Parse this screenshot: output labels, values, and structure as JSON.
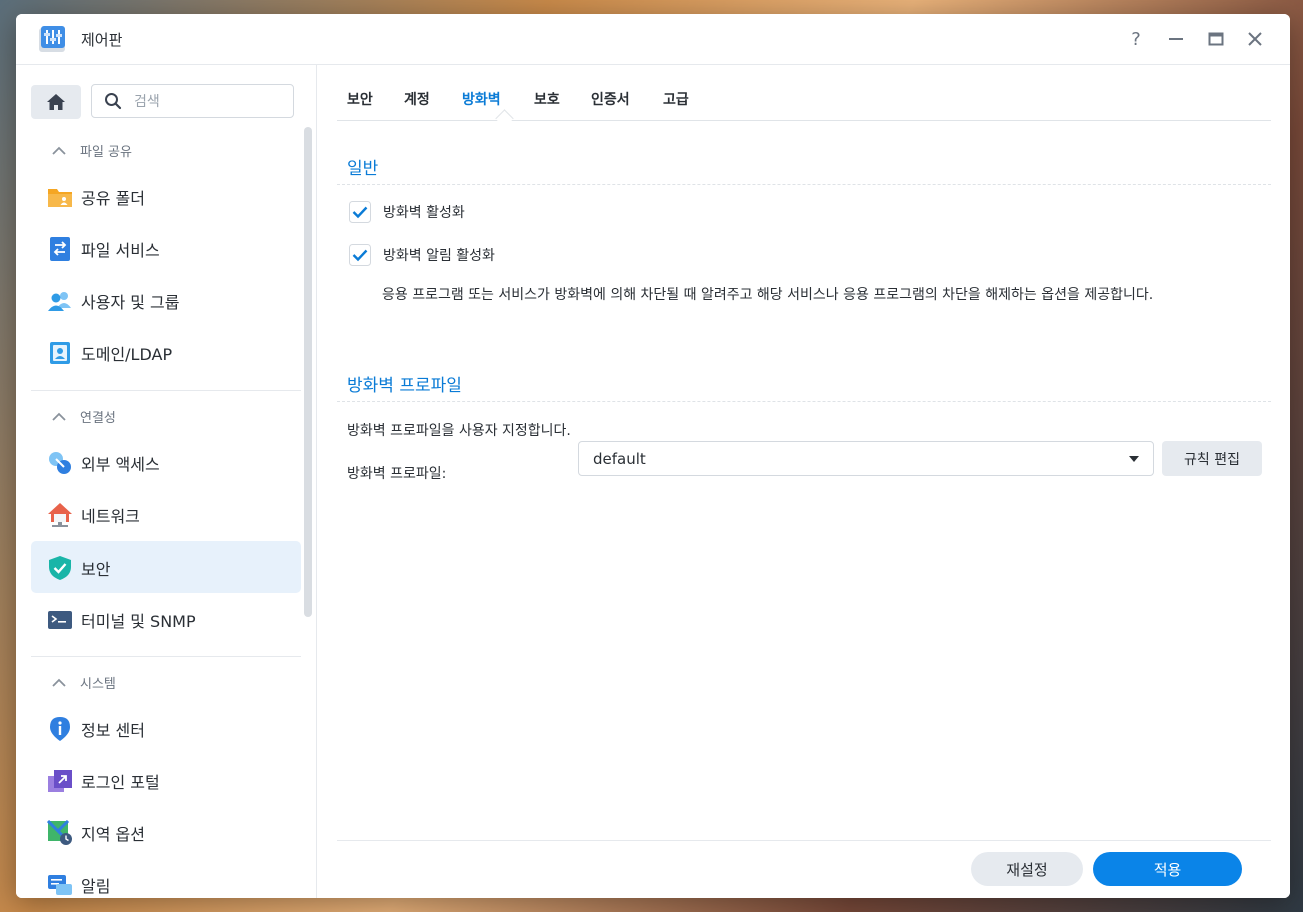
{
  "window": {
    "title": "제어판"
  },
  "sidebar": {
    "search_placeholder": "검색",
    "sections": [
      {
        "label": "파일 공유",
        "items": [
          {
            "label": "공유 폴더",
            "icon": "shared-folder-icon"
          },
          {
            "label": "파일 서비스",
            "icon": "file-services-icon"
          },
          {
            "label": "사용자 및 그룹",
            "icon": "user-group-icon"
          },
          {
            "label": "도메인/LDAP",
            "icon": "domain-ldap-icon"
          }
        ]
      },
      {
        "label": "연결성",
        "items": [
          {
            "label": "외부 액세스",
            "icon": "external-access-icon"
          },
          {
            "label": "네트워크",
            "icon": "network-icon"
          },
          {
            "label": "보안",
            "icon": "security-icon",
            "active": true
          },
          {
            "label": "터미널 및 SNMP",
            "icon": "terminal-icon"
          }
        ]
      },
      {
        "label": "시스템",
        "items": [
          {
            "label": "정보 센터",
            "icon": "info-center-icon"
          },
          {
            "label": "로그인 포털",
            "icon": "login-portal-icon"
          },
          {
            "label": "지역 옵션",
            "icon": "regional-options-icon"
          },
          {
            "label": "알림",
            "icon": "notification-icon"
          }
        ]
      }
    ]
  },
  "tabs": [
    {
      "label": "보안"
    },
    {
      "label": "계정"
    },
    {
      "label": "방화벽",
      "active": true
    },
    {
      "label": "보호"
    },
    {
      "label": "인증서"
    },
    {
      "label": "고급"
    }
  ],
  "general": {
    "title": "일반",
    "enable_firewall": {
      "label": "방화벽 활성화",
      "checked": true
    },
    "enable_notifications": {
      "label": "방화벽 알림 활성화",
      "checked": true
    },
    "description": "응용 프로그램 또는 서비스가 방화벽에 의해 차단될 때 알려주고 해당 서비스나 응용 프로그램의 차단을 해제하는 옵션을 제공합니다."
  },
  "profile": {
    "title": "방화벽 프로파일",
    "description": "방화벽 프로파일을 사용자 지정합니다.",
    "field_label": "방화벽 프로파일:",
    "selected": "default",
    "edit_rules_label": "규칙 편집"
  },
  "footer": {
    "reset_label": "재설정",
    "apply_label": "적용"
  },
  "colors": {
    "accent": "#0a7bd6",
    "apply_button": "#0a84e8",
    "active_nav": "#e7f1fb"
  }
}
